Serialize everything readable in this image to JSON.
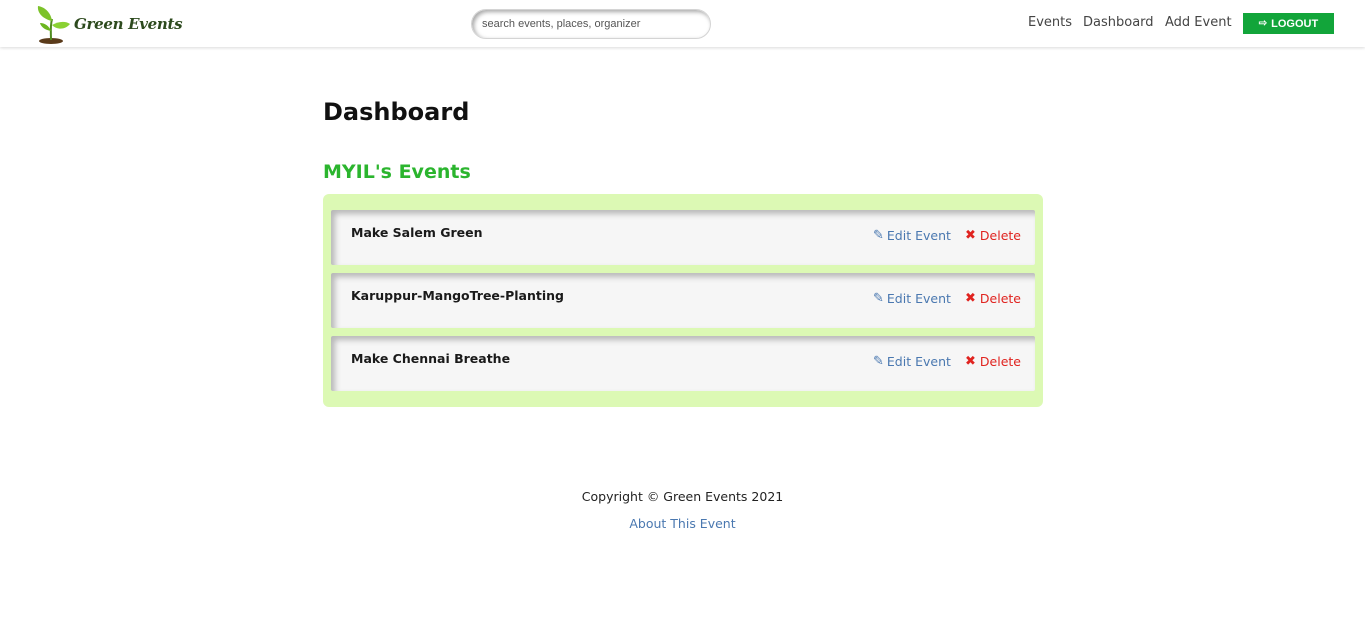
{
  "navbar": {
    "brand_name": "Green Events",
    "search_placeholder": "search events, places, organizer",
    "links": [
      {
        "label": "Events"
      },
      {
        "label": "Dashboard"
      },
      {
        "label": "Add Event"
      }
    ],
    "logout_label": "LOGOUT",
    "logout_icon": "sign-out-icon",
    "brand_color": "#12a53a"
  },
  "main": {
    "title": "Dashboard",
    "section_title": "MYIL's Events",
    "section_color": "#2bb52e",
    "panel_color": "#dcf9b4",
    "events": [
      {
        "name": "Make Salem Green",
        "edit_label": "Edit Event",
        "delete_label": "Delete"
      },
      {
        "name": "Karuppur-MangoTree-Planting",
        "edit_label": "Edit Event",
        "delete_label": "Delete"
      },
      {
        "name": "Make Chennai Breathe",
        "edit_label": "Edit Event",
        "delete_label": "Delete"
      }
    ]
  },
  "footer": {
    "copyright": "Copyright © Green Events 2021",
    "about_link": "About This Event"
  }
}
